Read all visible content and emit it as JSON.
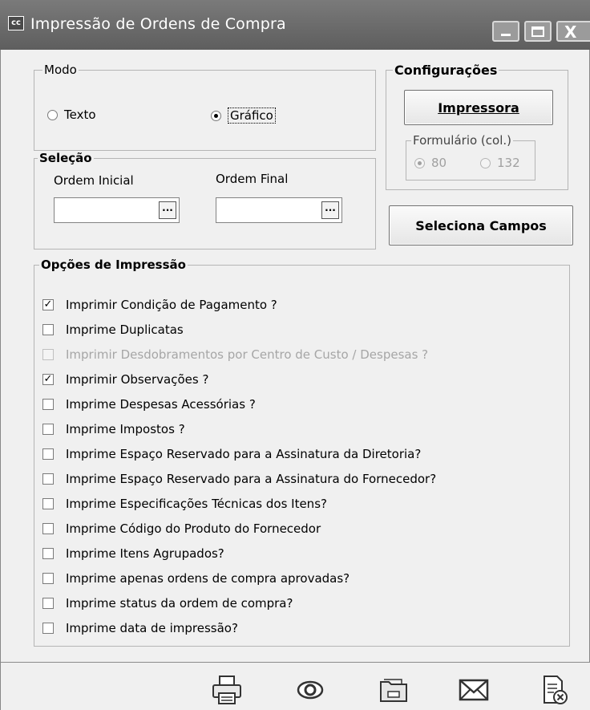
{
  "window": {
    "app_icon": "cc",
    "title": "Impressão de Ordens de Compra",
    "buttons": [
      "minimize-icon",
      "maximize-icon",
      "close-icon"
    ]
  },
  "modo": {
    "legend": "Modo",
    "options": [
      {
        "label": "Texto",
        "selected": false
      },
      {
        "label": "Gráfico",
        "selected": true
      }
    ]
  },
  "configuracoes": {
    "legend": "Configurações",
    "printer_button": "Impressora",
    "formulario": {
      "legend": "Formulário (col.)",
      "options": [
        {
          "label": "80",
          "selected": true
        },
        {
          "label": "132",
          "selected": false
        }
      ],
      "enabled": false
    }
  },
  "selecao": {
    "legend": "Seleção",
    "ordem_inicial": {
      "label": "Ordem Inicial",
      "value": "",
      "button": "..."
    },
    "ordem_final": {
      "label": "Ordem Final",
      "value": "",
      "button": "..."
    }
  },
  "seleciona_campos_button": "Seleciona Campos",
  "opcoes": {
    "legend": "Opções de Impressão",
    "items": [
      {
        "label": "Imprimir Condição de Pagamento ?",
        "checked": true,
        "enabled": true
      },
      {
        "label": "Imprime Duplicatas",
        "checked": false,
        "enabled": true
      },
      {
        "label": "Imprimir Desdobramentos por Centro de Custo / Despesas ?",
        "checked": false,
        "enabled": false
      },
      {
        "label": "Imprimir Observações ?",
        "checked": true,
        "enabled": true
      },
      {
        "label": "Imprime Despesas Acessórias ?",
        "checked": false,
        "enabled": true
      },
      {
        "label": "Imprime Impostos ?",
        "checked": false,
        "enabled": true
      },
      {
        "label": "Imprime Espaço Reservado para a Assinatura da Diretoria?",
        "checked": false,
        "enabled": true
      },
      {
        "label": "Imprime Espaço Reservado para a Assinatura do Fornecedor?",
        "checked": false,
        "enabled": true
      },
      {
        "label": "Imprime Especificações Técnicas dos Itens?",
        "checked": false,
        "enabled": true
      },
      {
        "label": "Imprime Código do Produto do Fornecedor",
        "checked": false,
        "enabled": true
      },
      {
        "label": "Imprime Itens Agrupados?",
        "checked": false,
        "enabled": true
      },
      {
        "label": "Imprime apenas ordens de compra aprovadas?",
        "checked": false,
        "enabled": true
      },
      {
        "label": "Imprime status da ordem de compra?",
        "checked": false,
        "enabled": true
      },
      {
        "label": "Imprime data de impressão?",
        "checked": false,
        "enabled": true
      }
    ]
  },
  "toolbar": {
    "icons": [
      "printer-icon",
      "preview-eye-icon",
      "folder-icon",
      "email-icon",
      "close-document-icon"
    ]
  }
}
